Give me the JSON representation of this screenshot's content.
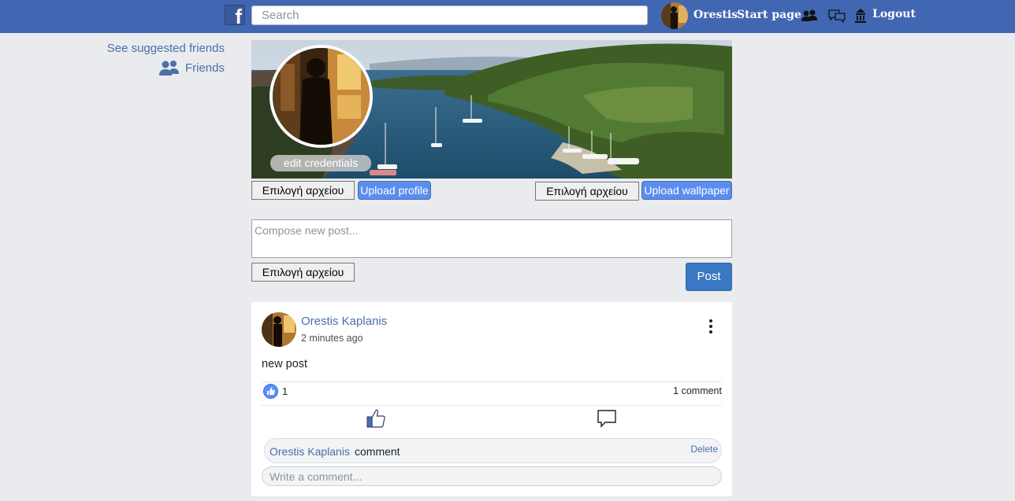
{
  "header": {
    "search_placeholder": "Search",
    "user_name": "Orestis",
    "start_page": "Start page",
    "logout": "Logout"
  },
  "sidebar": {
    "suggested": "See suggested friends",
    "friends": "Friends"
  },
  "profile": {
    "edit_credentials": "edit credentials",
    "choose_file": "Επιλογή αρχείου",
    "upload_profile": "Upload profile",
    "upload_wallpaper": "Upload wallpaper"
  },
  "composer": {
    "placeholder": "Compose new post...",
    "choose_file": "Επιλογή αρχείου",
    "post_label": "Post"
  },
  "post": {
    "author": "Orestis Kaplanis",
    "time": "2 minutes ago",
    "text": "new post",
    "likes": "1",
    "comments_count": "1 comment",
    "comments": [
      {
        "author": "Orestis Kaplanis",
        "text": "comment",
        "delete_label": "Delete"
      }
    ],
    "write_comment_placeholder": "Write a comment..."
  },
  "colors": {
    "topbar": "#4267b2",
    "link": "#4b6fab",
    "post_button": "#3b78c3",
    "upload_button": "#5b8def",
    "background": "#e9ebee"
  }
}
